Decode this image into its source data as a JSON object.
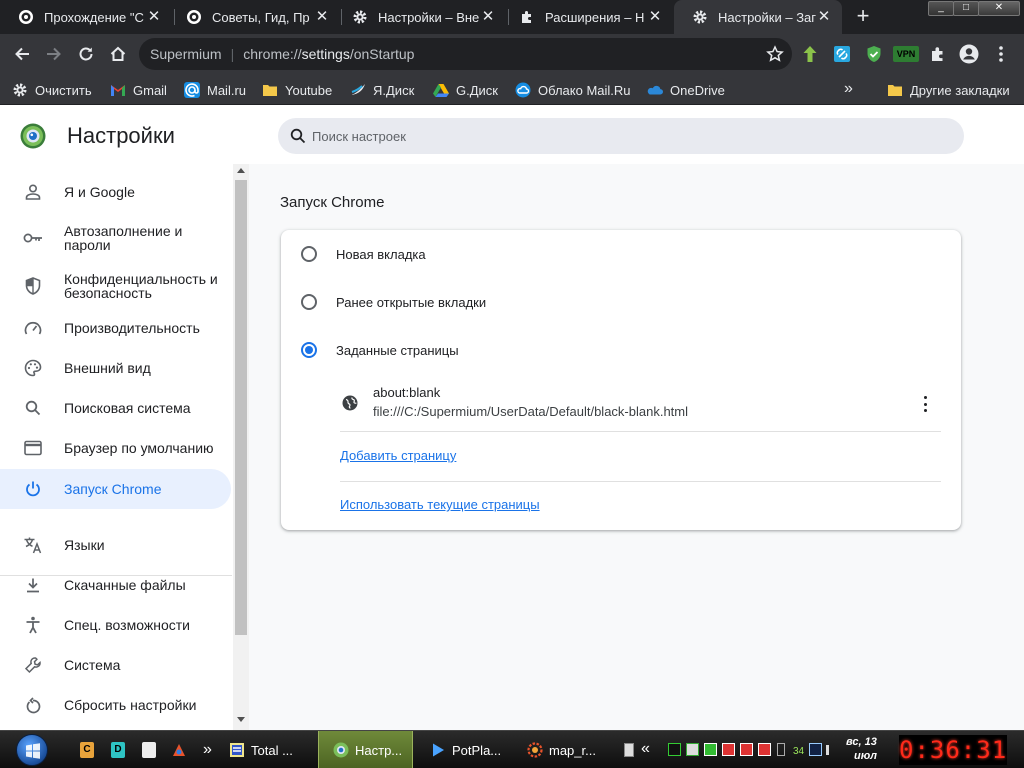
{
  "tabs": [
    {
      "title": "Прохождение \"С",
      "icon": "supermium-icon",
      "active": false
    },
    {
      "title": "Советы, Гид, Пр",
      "icon": "supermium-icon",
      "active": false
    },
    {
      "title": "Настройки – Вне",
      "icon": "gear-icon",
      "active": false
    },
    {
      "title": "Расширения – Н",
      "icon": "puzzle-icon",
      "active": false
    },
    {
      "title": "Настройки – Заг",
      "icon": "gear-icon",
      "active": true
    }
  ],
  "new_tab_symbol": "+",
  "window_controls": {
    "minimize": "_",
    "maximize": "□",
    "close": "✕"
  },
  "omnibox": {
    "brand": "Supermium",
    "separator": "|",
    "url_prefix": "chrome://",
    "url_bold": "settings",
    "url_suffix": "/onStartup"
  },
  "extensions_badge": "VPN",
  "bookmarks": [
    {
      "label": "Очистить",
      "icon": "gear-icon"
    },
    {
      "label": "Gmail",
      "icon": "gmail-icon"
    },
    {
      "label": "Mail.ru",
      "icon": "mailru-icon"
    },
    {
      "label": "Youtube",
      "icon": "folder-icon"
    },
    {
      "label": "Я.Диск",
      "icon": "yandex-disk-icon"
    },
    {
      "label": "G.Диск",
      "icon": "google-drive-icon"
    },
    {
      "label": "Облако Mail.Ru",
      "icon": "cloud-icon"
    },
    {
      "label": "OneDrive",
      "icon": "onedrive-icon"
    }
  ],
  "bookmarks_more": "»",
  "other_bookmarks": "Другие закладки",
  "settings": {
    "title": "Настройки",
    "search_placeholder": "Поиск настроек",
    "nav": [
      {
        "label": "Я и Google",
        "icon": "person-icon"
      },
      {
        "label": "Автозаполнение и пароли",
        "icon": "key-icon"
      },
      {
        "label": "Конфиденциальность и безопасность",
        "icon": "shield-icon"
      },
      {
        "label": "Производительность",
        "icon": "speedometer-icon"
      },
      {
        "label": "Внешний вид",
        "icon": "palette-icon"
      },
      {
        "label": "Поисковая система",
        "icon": "search-icon"
      },
      {
        "label": "Браузер по умолчанию",
        "icon": "browser-window-icon"
      },
      {
        "label": "Запуск Chrome",
        "icon": "power-icon"
      },
      {
        "label": "Языки",
        "icon": "translate-icon"
      },
      {
        "label": "Скачанные файлы",
        "icon": "download-icon"
      },
      {
        "label": "Спец. возможности",
        "icon": "accessibility-icon"
      },
      {
        "label": "Система",
        "icon": "wrench-icon"
      },
      {
        "label": "Сбросить настройки",
        "icon": "reset-icon"
      }
    ],
    "active_nav": "Запуск Chrome",
    "section_title": "Запуск Chrome",
    "options": [
      {
        "label": "Новая вкладка",
        "checked": false
      },
      {
        "label": "Ранее открытые вкладки",
        "checked": false
      },
      {
        "label": "Заданные страницы",
        "checked": true
      }
    ],
    "startup_page": {
      "name": "about:blank",
      "url": "file:///C:/Supermium/UserData/Default/black-blank.html"
    },
    "add_page_link": "Добавить страницу",
    "use_current_link": "Использовать текущие страницы"
  },
  "taskbar": {
    "quick_launch": [
      "C",
      "D"
    ],
    "chevron": "»",
    "tasks": [
      {
        "label": "Total ...",
        "icon": "total-commander-icon",
        "active": false
      },
      {
        "label": "Настр...",
        "icon": "supermium-icon",
        "active": true
      },
      {
        "label": "PotPla...",
        "icon": "potplayer-icon",
        "active": false
      },
      {
        "label": "map_r...",
        "icon": "map-app-icon",
        "active": false
      }
    ],
    "tray_chevron": "«",
    "tray_number": "34",
    "date_day": "вс, 13",
    "date_month": "июл",
    "clock": "0:36:31"
  },
  "colors": {
    "accent": "#1a73e8",
    "active_nav_bg": "#e8f0fe",
    "chrome_dark": "#35363a",
    "tabstrip": "#202124",
    "clock_red": "#ff2a1a"
  }
}
